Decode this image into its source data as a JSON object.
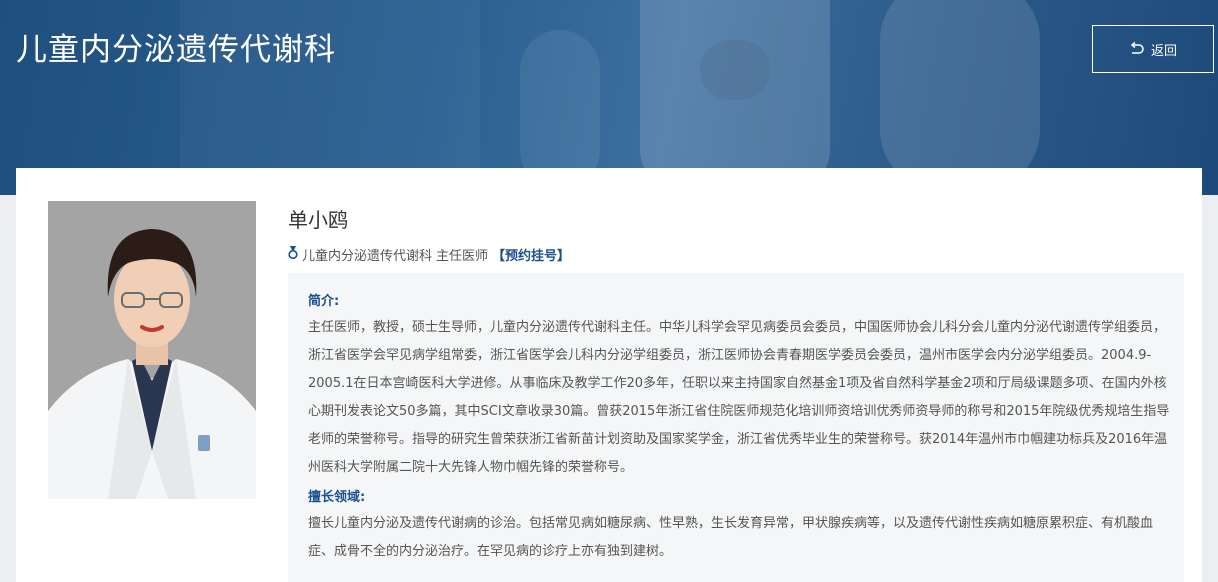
{
  "header": {
    "title": "儿童内分泌遗传代谢科",
    "back_label": "返回"
  },
  "doctor": {
    "name": "单小鸥",
    "department": "儿童内分泌遗传代谢科",
    "position": "主任医师",
    "appointment_link": "【预约挂号】",
    "intro_label": "简介:",
    "intro_text": "主任医师，教授，硕士生导师，儿童内分泌遗传代谢科主任。中华儿科学会罕见病委员会委员，中国医师协会儿科分会儿童内分泌代谢遗传学组委员，浙江省医学会罕见病学组常委，浙江省医学会儿科内分泌学组委员，浙江医师协会青春期医学委员会委员，温州市医学会内分泌学组委员。2004.9-2005.1在日本宫崎医科大学进修。从事临床及教学工作20多年，任职以来主持国家自然基金1项及省自然科学基金2项和厅局级课题多项、在国内外核心期刊发表论文50多篇，其中SCI文章收录30篇。曾获2015年浙江省住院医师规范化培训师资培训优秀师资导师的称号和2015年院级优秀规培生指导老师的荣誉称号。指导的研究生曾荣获浙江省新苗计划资助及国家奖学金，浙江省优秀毕业生的荣誉称号。获2014年温州市巾帼建功标兵及2016年温州医科大学附属二院十大先锋人物巾帼先锋的荣誉称号。",
    "specialty_label": "擅长领域:",
    "specialty_text": "擅长儿童内分泌及遗传代谢病的诊治。包括常见病如糖尿病、性早熟，生长发育异常，甲状腺疾病等，以及遗传代谢性疾病如糖原累积症、有机酸血症、成骨不全的内分泌治疗。在罕见病的诊疗上亦有独到建树。"
  },
  "icons": {
    "back": "return-arrow-icon",
    "badge": "medal-icon"
  },
  "colors": {
    "banner": "#2a5f91",
    "accent": "#1c4f8c",
    "body_text": "#555555",
    "bio_bg": "#f5f6f7"
  }
}
